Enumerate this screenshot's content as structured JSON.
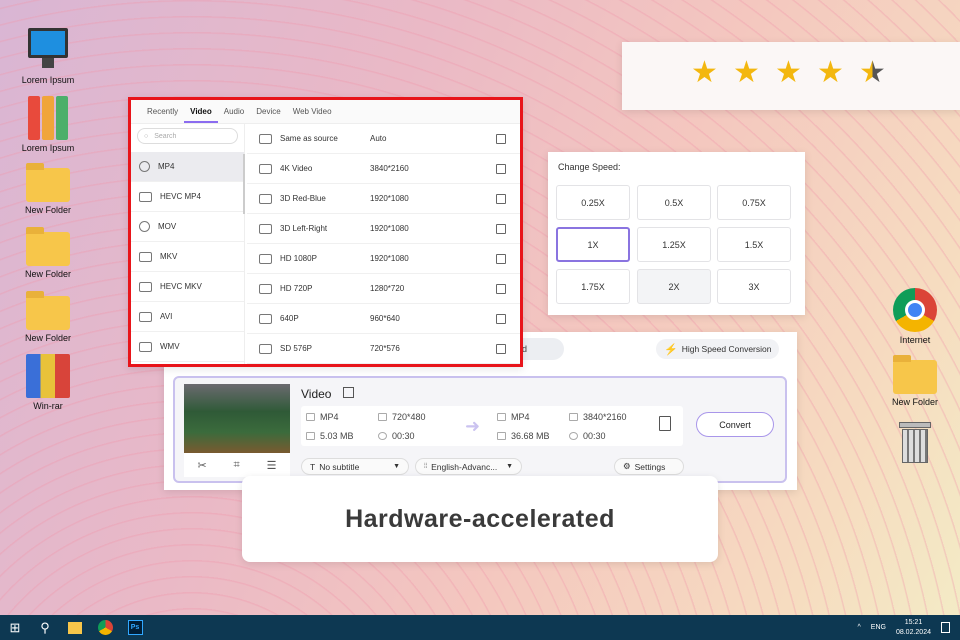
{
  "desktop_left": [
    {
      "label": "Lorem Ipsum",
      "icon": "computer-icon"
    },
    {
      "label": "Lorem Ipsum",
      "icon": "binders-icon"
    },
    {
      "label": "New Folder",
      "icon": "folder-icon"
    },
    {
      "label": "New Folder",
      "icon": "folder-icon"
    },
    {
      "label": "New Folder",
      "icon": "folder-icon"
    },
    {
      "label": "Win-rar",
      "icon": "winrar-icon"
    }
  ],
  "desktop_right": [
    {
      "label": "Internet",
      "icon": "chrome-icon"
    },
    {
      "label": "New Folder",
      "icon": "folder-icon"
    },
    {
      "label": "",
      "icon": "trash-icon"
    }
  ],
  "rating": {
    "value": 4.5,
    "max": 5,
    "star_glyph": "★"
  },
  "format_dialog": {
    "tabs": [
      "Recently",
      "Video",
      "Audio",
      "Device",
      "Web Video"
    ],
    "active_tab": "Video",
    "search_placeholder": "Search",
    "formats": [
      "MP4",
      "HEVC MP4",
      "MOV",
      "MKV",
      "HEVC MKV",
      "AVI",
      "WMV"
    ],
    "selected_format": "MP4",
    "presets": [
      {
        "name": "Same as source",
        "res": "Auto"
      },
      {
        "name": "4K Video",
        "res": "3840*2160"
      },
      {
        "name": "3D Red-Blue",
        "res": "1920*1080"
      },
      {
        "name": "3D Left-Right",
        "res": "1920*1080"
      },
      {
        "name": "HD 1080P",
        "res": "1920*1080"
      },
      {
        "name": "HD 720P",
        "res": "1280*720"
      },
      {
        "name": "640P",
        "res": "960*640"
      },
      {
        "name": "SD 576P",
        "res": "720*576"
      }
    ]
  },
  "speed": {
    "title": "Change Speed:",
    "options": [
      "0.25X",
      "0.5X",
      "0.75X",
      "1X",
      "1.25X",
      "1.5X",
      "1.75X",
      "2X",
      "3X"
    ],
    "selected": "1X"
  },
  "converter": {
    "tab_partial": "ned",
    "high_speed": "High Speed Conversion",
    "title": "Video",
    "src": {
      "format": "MP4",
      "res": "720*480",
      "size": "5.03 MB",
      "duration": "00:30"
    },
    "dst": {
      "format": "MP4",
      "res": "3840*2160",
      "size": "36.68 MB",
      "duration": "00:30"
    },
    "convert": "Convert",
    "subtitle": "No subtitle",
    "audio": "English-Advanc...",
    "settings": "Settings"
  },
  "caption": "Hardware-accelerated",
  "taskbar": {
    "lang": "ENG",
    "time": "15:21",
    "date": "08.02.2024"
  },
  "colors": {
    "accent": "#8b6cf0",
    "highlight_border": "#e8141a",
    "star": "#f3b70f",
    "taskbar": "#0d3852"
  }
}
